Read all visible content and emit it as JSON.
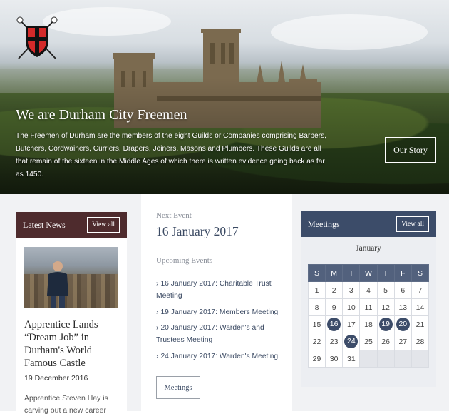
{
  "hero": {
    "crest_text": "Durham City Freemen",
    "title": "We are Durham City Freemen",
    "text": "The Freemen of Durham are the members of the eight Guilds or Companies comprising Barbers, Butchers, Cordwainers, Curriers, Drapers, Joiners, Masons and Plumbers. These Guilds are all that remain of the sixteen in the Middle Ages of which there is written evidence going back as far as 1450.",
    "button": "Our Story"
  },
  "news": {
    "header": "Latest News",
    "view_all": "View all",
    "title": "Apprentice Lands “Dream Job” in Durham's World Famous Castle",
    "date": "19 December 2016",
    "excerpt": "Apprentice Steven Hay is carving out a new career"
  },
  "events": {
    "next_label": "Next Event",
    "next_date": "16 January 2017",
    "upcoming_label": "Upcoming Events",
    "items": [
      "16 January 2017: Charitable Trust Meeting",
      "19 January 2017: Members Meeting",
      "20 January 2017: Warden's and Trustees Meeting",
      "24 January 2017: Warden's Meeting"
    ],
    "button": "Meetings"
  },
  "calendar": {
    "header": "Meetings",
    "view_all": "View all",
    "month": "January",
    "weekdays": [
      "S",
      "M",
      "T",
      "W",
      "T",
      "F",
      "S"
    ],
    "weeks": [
      [
        "1",
        "2",
        "3",
        "4",
        "5",
        "6",
        "7"
      ],
      [
        "8",
        "9",
        "10",
        "11",
        "12",
        "13",
        "14"
      ],
      [
        "15",
        "16",
        "17",
        "18",
        "19",
        "20",
        "21"
      ],
      [
        "22",
        "23",
        "24",
        "25",
        "26",
        "27",
        "28"
      ],
      [
        "29",
        "30",
        "31",
        "",
        "",
        "",
        ""
      ]
    ],
    "highlighted": [
      "16",
      "19",
      "20",
      "24"
    ],
    "accent": "#3c4c69"
  },
  "colors": {
    "news_header": "#4e2b2d",
    "calendar_header": "#3c4c69",
    "link_text": "#3b4a63"
  }
}
